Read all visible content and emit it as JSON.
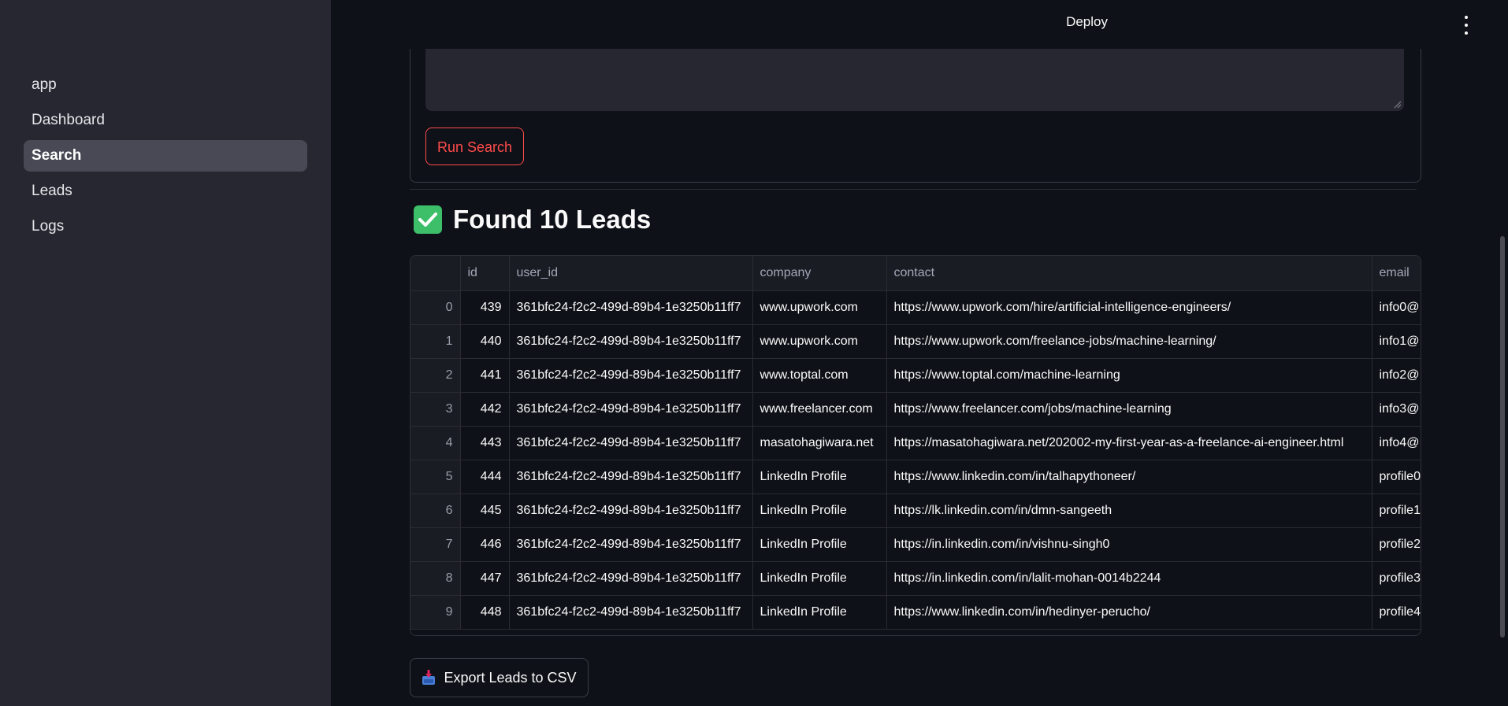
{
  "sidebar": {
    "items": [
      {
        "label": "app"
      },
      {
        "label": "Dashboard"
      },
      {
        "label": "Search"
      },
      {
        "label": "Leads"
      },
      {
        "label": "Logs"
      }
    ]
  },
  "header": {
    "deploy_label": "Deploy"
  },
  "form": {
    "textarea_value": "",
    "run_button_label": "Run Search"
  },
  "results": {
    "heading": "Found 10 Leads"
  },
  "table": {
    "columns": [
      "",
      "id",
      "user_id",
      "company",
      "contact",
      "email"
    ],
    "rows": [
      [
        "0",
        "439",
        "361bfc24-f2c2-499d-89b4-1e3250b11ff7",
        "www.upwork.com",
        "https://www.upwork.com/hire/artificial-intelligence-engineers/",
        "info0@"
      ],
      [
        "1",
        "440",
        "361bfc24-f2c2-499d-89b4-1e3250b11ff7",
        "www.upwork.com",
        "https://www.upwork.com/freelance-jobs/machine-learning/",
        "info1@"
      ],
      [
        "2",
        "441",
        "361bfc24-f2c2-499d-89b4-1e3250b11ff7",
        "www.toptal.com",
        "https://www.toptal.com/machine-learning",
        "info2@"
      ],
      [
        "3",
        "442",
        "361bfc24-f2c2-499d-89b4-1e3250b11ff7",
        "www.freelancer.com",
        "https://www.freelancer.com/jobs/machine-learning",
        "info3@"
      ],
      [
        "4",
        "443",
        "361bfc24-f2c2-499d-89b4-1e3250b11ff7",
        "masatohagiwara.net",
        "https://masatohagiwara.net/202002-my-first-year-as-a-freelance-ai-engineer.html",
        "info4@"
      ],
      [
        "5",
        "444",
        "361bfc24-f2c2-499d-89b4-1e3250b11ff7",
        "LinkedIn Profile",
        "https://www.linkedin.com/in/talhapythoneer/",
        "profile0"
      ],
      [
        "6",
        "445",
        "361bfc24-f2c2-499d-89b4-1e3250b11ff7",
        "LinkedIn Profile",
        "https://lk.linkedin.com/in/dmn-sangeeth",
        "profile1"
      ],
      [
        "7",
        "446",
        "361bfc24-f2c2-499d-89b4-1e3250b11ff7",
        "LinkedIn Profile",
        "https://in.linkedin.com/in/vishnu-singh0",
        "profile2"
      ],
      [
        "8",
        "447",
        "361bfc24-f2c2-499d-89b4-1e3250b11ff7",
        "LinkedIn Profile",
        "https://in.linkedin.com/in/lalit-mohan-0014b2244",
        "profile3"
      ],
      [
        "9",
        "448",
        "361bfc24-f2c2-499d-89b4-1e3250b11ff7",
        "LinkedIn Profile",
        "https://www.linkedin.com/in/hedinyer-perucho/",
        "profile4"
      ]
    ]
  },
  "export": {
    "label": "Export Leads to CSV",
    "icon": "inbox-tray-icon"
  },
  "colors": {
    "accent": "#ff4b4b",
    "success": "#3dbf6a",
    "sidebar_bg": "#262730",
    "app_bg": "#0e1117"
  }
}
